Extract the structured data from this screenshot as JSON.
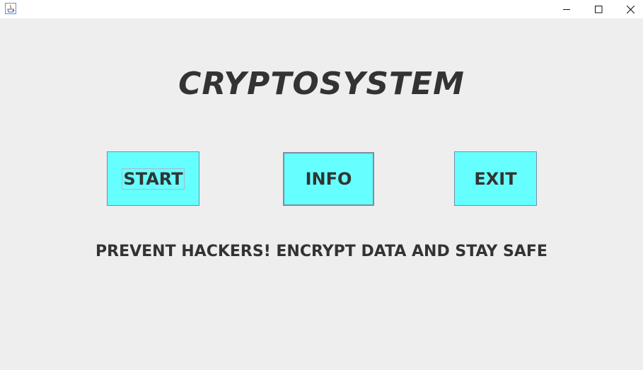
{
  "window": {
    "controls": {
      "minimize_icon": "minimize-icon",
      "maximize_icon": "maximize-icon",
      "close_icon": "close-icon"
    }
  },
  "main": {
    "title": "CRYPTOSYSTEM",
    "buttons": {
      "start": "START",
      "info": "INFO",
      "exit": "EXIT"
    },
    "tagline": "PREVENT HACKERS! ENCRYPT DATA AND STAY SAFE"
  },
  "colors": {
    "background": "#eeeeee",
    "button_fill": "#66ffff",
    "text": "#333333"
  }
}
